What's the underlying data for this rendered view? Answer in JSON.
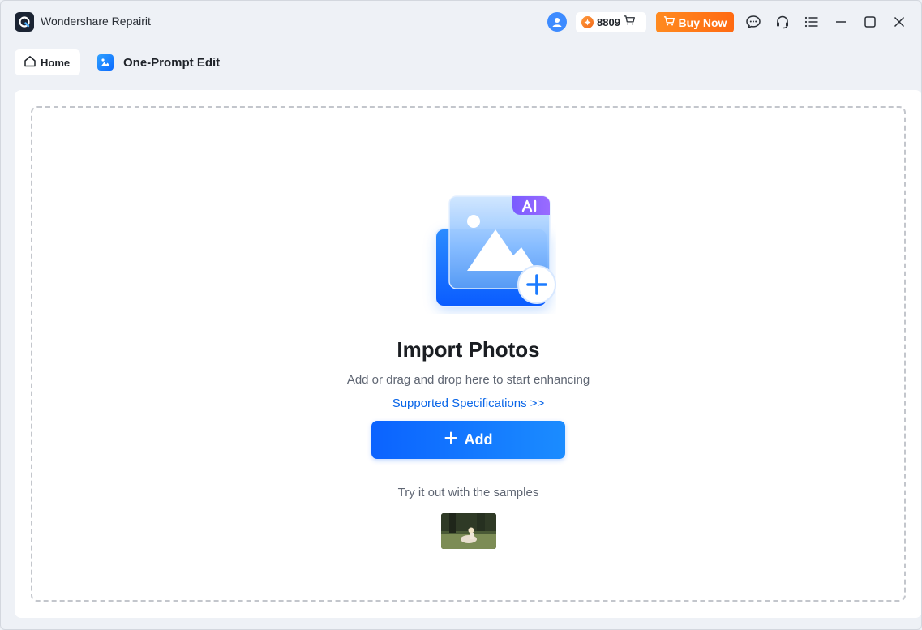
{
  "app": {
    "title": "Wondershare Repairit"
  },
  "header": {
    "credits": "8809",
    "buy_label": "Buy Now"
  },
  "breadcrumb": {
    "home_label": "Home",
    "feature_title": "One-Prompt Edit"
  },
  "illustration": {
    "badge": "AI"
  },
  "main": {
    "title": "Import Photos",
    "subtitle": "Add or drag and drop here to start enhancing",
    "spec_link": "Supported Specifications >>",
    "add_label": "Add",
    "samples_text": "Try it out with the samples"
  },
  "colors": {
    "accent": "#0B63FF",
    "buy": "#FF7A18",
    "link": "#0A66E8"
  }
}
